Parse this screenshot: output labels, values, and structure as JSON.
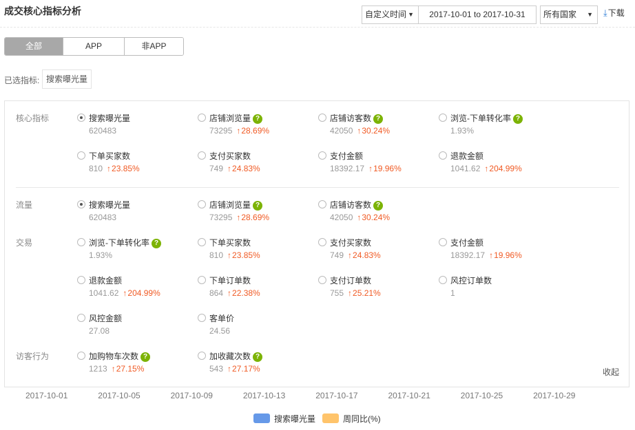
{
  "header": {
    "title": "成交核心指标分析",
    "time_select": "自定义时间",
    "date_range": "2017-10-01 to 2017-10-31",
    "country_select": "所有国家",
    "download": "下载"
  },
  "segments": [
    {
      "label": "全部",
      "active": true
    },
    {
      "label": "APP",
      "active": false
    },
    {
      "label": "非APP",
      "active": false
    }
  ],
  "selected": {
    "label": "已选指标:",
    "chip": "搜索曝光量"
  },
  "groups": [
    {
      "label": "核心指标"
    },
    {
      "label": "流量"
    },
    {
      "label": "交易"
    },
    {
      "label": "访客行为"
    }
  ],
  "core_metrics": [
    {
      "name": "搜索曝光量",
      "value": "620483",
      "change": "",
      "help": false,
      "checked": true
    },
    {
      "name": "店铺浏览量",
      "value": "73295",
      "change": "28.69%",
      "help": true,
      "checked": false
    },
    {
      "name": "店铺访客数",
      "value": "42050",
      "change": "30.24%",
      "help": true,
      "checked": false
    },
    {
      "name": "浏览-下单转化率",
      "value": "1.93%",
      "change": "",
      "help": true,
      "checked": false
    },
    {
      "name": "下单买家数",
      "value": "810",
      "change": "23.85%",
      "help": false,
      "checked": false
    },
    {
      "name": "支付买家数",
      "value": "749",
      "change": "24.83%",
      "help": false,
      "checked": false
    },
    {
      "name": "支付金额",
      "value": "18392.17",
      "change": "19.96%",
      "help": false,
      "checked": false
    },
    {
      "name": "退款金额",
      "value": "1041.62",
      "change": "204.99%",
      "help": false,
      "checked": false
    }
  ],
  "traffic_metrics": [
    {
      "name": "搜索曝光量",
      "value": "620483",
      "change": "",
      "help": false,
      "checked": true
    },
    {
      "name": "店铺浏览量",
      "value": "73295",
      "change": "28.69%",
      "help": true,
      "checked": false
    },
    {
      "name": "店铺访客数",
      "value": "42050",
      "change": "30.24%",
      "help": true,
      "checked": false
    }
  ],
  "trade_metrics": [
    {
      "name": "浏览-下单转化率",
      "value": "1.93%",
      "change": "",
      "help": true,
      "checked": false
    },
    {
      "name": "下单买家数",
      "value": "810",
      "change": "23.85%",
      "help": false,
      "checked": false
    },
    {
      "name": "支付买家数",
      "value": "749",
      "change": "24.83%",
      "help": false,
      "checked": false
    },
    {
      "name": "支付金额",
      "value": "18392.17",
      "change": "19.96%",
      "help": false,
      "checked": false
    },
    {
      "name": "退款金额",
      "value": "1041.62",
      "change": "204.99%",
      "help": false,
      "checked": false
    },
    {
      "name": "下单订单数",
      "value": "864",
      "change": "22.38%",
      "help": false,
      "checked": false
    },
    {
      "name": "支付订单数",
      "value": "755",
      "change": "25.21%",
      "help": false,
      "checked": false
    },
    {
      "name": "风控订单数",
      "value": "1",
      "change": "",
      "help": false,
      "checked": false
    },
    {
      "name": "风控金额",
      "value": "27.08",
      "change": "",
      "help": false,
      "checked": false
    },
    {
      "name": "客单价",
      "value": "24.56",
      "change": "",
      "help": false,
      "checked": false
    }
  ],
  "visitor_metrics": [
    {
      "name": "加购物车次数",
      "value": "1213",
      "change": "27.15%",
      "help": true,
      "checked": false
    },
    {
      "name": "加收藏次数",
      "value": "543",
      "change": "27.17%",
      "help": true,
      "checked": false
    }
  ],
  "up_arrow": "↑",
  "help_mark": "?",
  "collapse_label": "收起",
  "axis_ticks": [
    "2017-10-01",
    "2017-10-05",
    "2017-10-09",
    "2017-10-13",
    "2017-10-17",
    "2017-10-21",
    "2017-10-25",
    "2017-10-29"
  ],
  "legend": [
    {
      "label": "搜索曝光量",
      "color": "#6699e8"
    },
    {
      "label": "周同比(%)",
      "color": "#ffc46b"
    }
  ],
  "colors": {
    "accent_change": "#f05a24",
    "help_badge": "#7cb305",
    "segment_active": "#a8a8a8"
  },
  "icons": {
    "download": "download-icon",
    "dropdown": "caret-down-icon",
    "help": "help-icon"
  }
}
